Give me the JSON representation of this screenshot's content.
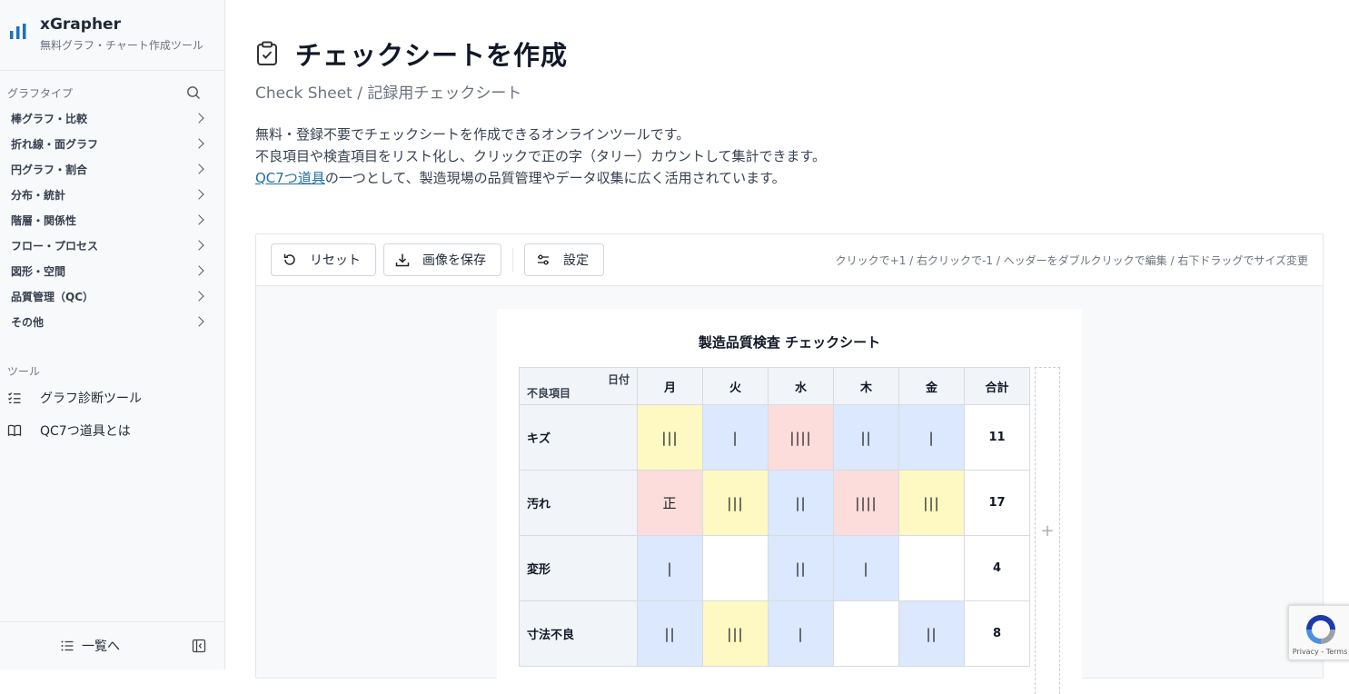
{
  "brand": {
    "title": "xGrapher",
    "subtitle": "無料グラフ・チャート作成ツール"
  },
  "sidebar": {
    "section_label": "グラフタイプ",
    "items": [
      {
        "label": "棒グラフ・比較"
      },
      {
        "label": "折れ線・面グラフ"
      },
      {
        "label": "円グラフ・割合"
      },
      {
        "label": "分布・統計"
      },
      {
        "label": "階層・関係性"
      },
      {
        "label": "フロー・プロセス"
      },
      {
        "label": "図形・空間"
      },
      {
        "label": "品質管理（QC）"
      },
      {
        "label": "その他"
      }
    ],
    "tools_label": "ツール",
    "tools": [
      {
        "label": "グラフ診断ツール",
        "icon": "list-check-icon"
      },
      {
        "label": "QC7つ道具とは",
        "icon": "book-icon"
      }
    ],
    "footer_label": "一覧へ"
  },
  "page": {
    "title": "チェックシートを作成",
    "subtitle": "Check Sheet / 記録用チェックシート",
    "desc_line1": "無料・登録不要でチェックシートを作成できるオンラインツールです。",
    "desc_line2": "不良項目や検査項目をリスト化し、クリックで正の字（タリー）カウントして集計できます。",
    "desc_link": "QC7つ道具",
    "desc_line3_rest": "の一つとして、製造現場の品質管理やデータ収集に広く活用されています。"
  },
  "toolbar": {
    "reset_label": "リセット",
    "save_label": "画像を保存",
    "settings_label": "設定",
    "hint": "クリックで+1 / 右クリックで-1 / ヘッダーをダブルクリックで編集 / 右下ドラッグでサイズ変更"
  },
  "sheet": {
    "title": "製造品質検査 チェックシート",
    "corner_date": "日付",
    "corner_item": "不良項目",
    "days": [
      "月",
      "火",
      "水",
      "木",
      "金"
    ],
    "total_label": "合計",
    "rows": [
      {
        "label": "キズ",
        "cells": [
          "|||",
          "|",
          "||||",
          "||",
          "|"
        ],
        "colors": [
          "yellow",
          "blue",
          "red",
          "blue",
          "blue"
        ],
        "total": "11"
      },
      {
        "label": "汚れ",
        "cells": [
          "正",
          "|||",
          "||",
          "||||",
          "|||"
        ],
        "colors": [
          "red",
          "yellow",
          "blue",
          "red",
          "yellow"
        ],
        "total": "17"
      },
      {
        "label": "変形",
        "cells": [
          "|",
          "",
          "||",
          "|",
          ""
        ],
        "colors": [
          "blue",
          "white",
          "blue",
          "blue",
          "white"
        ],
        "total": "4"
      },
      {
        "label": "寸法不良",
        "cells": [
          "||",
          "|||",
          "|",
          "",
          "||"
        ],
        "colors": [
          "blue",
          "yellow",
          "blue",
          "white",
          "blue"
        ],
        "total": "8"
      }
    ],
    "add_column_label": "+"
  },
  "recaptcha": {
    "text": "Privacy - Terms"
  }
}
